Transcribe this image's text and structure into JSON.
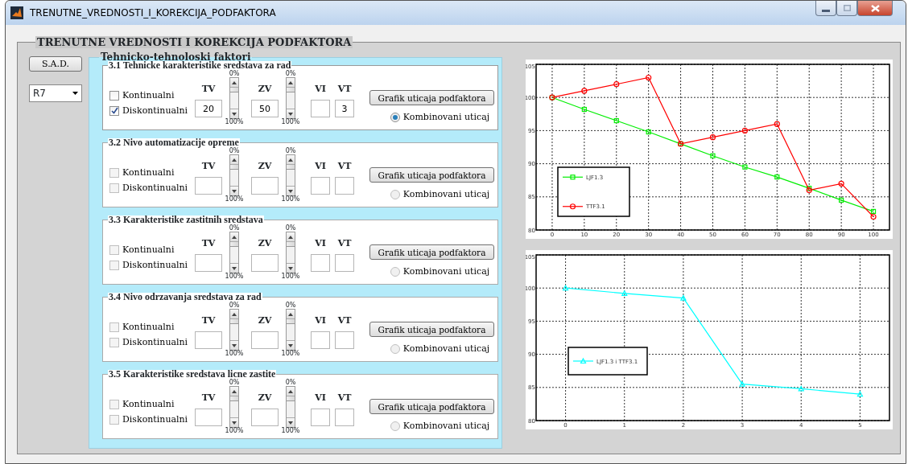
{
  "window": {
    "title": "TRENUTNE_VREDNOSTI_I_KOREKCIJA_PODFAKTORA"
  },
  "panel": {
    "title": "TRENUTNE VREDNOSTI I KOREKCIJA PODFAKTORA"
  },
  "sad_button": "S.A.D.",
  "dropdown": {
    "value": "R7"
  },
  "factors": {
    "title": "Tehnicko-tehnoloski faktori",
    "groups": [
      {
        "title": "3.1 Tehnicke karakteristike sredstava za rad",
        "enabled": true,
        "options": [
          {
            "label": "Kontinualni",
            "checked": false
          },
          {
            "label": "Diskontinualni",
            "checked": true
          }
        ],
        "tv_label": "TV",
        "tv_value": "20",
        "tv_min": "0%",
        "tv_max": "100%",
        "zv_label": "ZV",
        "zv_value": "50",
        "zv_min": "0%",
        "zv_max": "100%",
        "vi_label": "VI",
        "vt_label": "VT",
        "vt_value": "3",
        "button": "Grafik uticaja podfaktora",
        "radio": {
          "label": "Kombinovani uticaj",
          "selected": true
        }
      },
      {
        "title": "3.2 Nivo automatizacije opreme",
        "enabled": false,
        "options": [
          {
            "label": "Kontinualni",
            "checked": false
          },
          {
            "label": "Diskontinualni",
            "checked": false
          }
        ],
        "tv_label": "TV",
        "tv_min": "0%",
        "tv_max": "100%",
        "zv_label": "ZV",
        "zv_min": "0%",
        "zv_max": "100%",
        "vi_label": "VI",
        "vt_label": "VT",
        "button": "Grafik uticaja podfaktora",
        "radio": {
          "label": "Kombinovani uticaj",
          "selected": false
        }
      },
      {
        "title": "3.3 Karakteristike zastitnih sredstava",
        "enabled": false,
        "options": [
          {
            "label": "Kontinualni",
            "checked": false
          },
          {
            "label": "Diskontinualni",
            "checked": false
          }
        ],
        "tv_label": "TV",
        "tv_min": "0%",
        "tv_max": "100%",
        "zv_label": "ZV",
        "zv_min": "0%",
        "zv_max": "100%",
        "vi_label": "VI",
        "vt_label": "VT",
        "button": "Grafik uticaja podfaktora",
        "radio": {
          "label": "Kombinovani uticaj",
          "selected": false
        }
      },
      {
        "title": "3.4 Nivo odrzavanja sredstava za rad",
        "enabled": false,
        "options": [
          {
            "label": "Kontinualni",
            "checked": false
          },
          {
            "label": "Diskontinualni",
            "checked": false
          }
        ],
        "tv_label": "TV",
        "tv_min": "0%",
        "tv_max": "100%",
        "zv_label": "ZV",
        "zv_min": "0%",
        "zv_max": "100%",
        "vi_label": "VI",
        "vt_label": "VT",
        "button": "Grafik uticaja podfaktora",
        "radio": {
          "label": "Kombinovani uticaj",
          "selected": false
        }
      },
      {
        "title": "3.5 Karakteristike sredstava licne zastite",
        "enabled": false,
        "options": [
          {
            "label": "Kontinualni",
            "checked": false
          },
          {
            "label": "Diskontinualni",
            "checked": false
          }
        ],
        "tv_label": "TV",
        "tv_min": "0%",
        "tv_max": "100%",
        "zv_label": "ZV",
        "zv_min": "0%",
        "zv_max": "100%",
        "vi_label": "VI",
        "vt_label": "VT",
        "button": "Grafik uticaja podfaktora",
        "radio": {
          "label": "Kombinovani uticaj",
          "selected": false
        }
      }
    ]
  },
  "charts": [
    {
      "chart_data": {
        "type": "line",
        "grid": true,
        "legend": true,
        "x": [
          0,
          10,
          20,
          30,
          40,
          50,
          60,
          70,
          80,
          90,
          100
        ],
        "xlim": [
          -5,
          105
        ],
        "ylim": [
          80,
          105
        ],
        "xticks": [
          0,
          10,
          20,
          30,
          40,
          50,
          60,
          70,
          80,
          90,
          100
        ],
        "yticks": [
          80,
          85,
          90,
          95,
          100,
          105
        ],
        "series": [
          {
            "name": "LJF1.3",
            "color": "#00ee00",
            "marker": "square",
            "values": [
              100,
              98.2,
              96.5,
              94.8,
              93,
              91.2,
              89.5,
              88,
              86.3,
              84.5,
              82.8
            ]
          },
          {
            "name": "TTF3.1",
            "color": "#ff0000",
            "marker": "circle",
            "values": [
              100,
              101,
              102,
              103,
              93,
              94,
              95,
              96,
              86,
              87,
              82
            ]
          }
        ]
      }
    },
    {
      "chart_data": {
        "type": "line",
        "grid": true,
        "legend": true,
        "x": [
          0,
          1,
          2,
          3,
          4,
          5
        ],
        "xlim": [
          -0.5,
          5.5
        ],
        "ylim": [
          80,
          105
        ],
        "xticks": [
          0,
          1,
          2,
          3,
          4,
          5
        ],
        "yticks": [
          80,
          85,
          90,
          95,
          100,
          105
        ],
        "series": [
          {
            "name": "LJF1.3 i TTF3.1",
            "color": "#00ffff",
            "marker": "triangle",
            "values": [
              100,
              99.2,
              98.5,
              85.5,
              84.8,
              84
            ]
          }
        ]
      }
    }
  ]
}
